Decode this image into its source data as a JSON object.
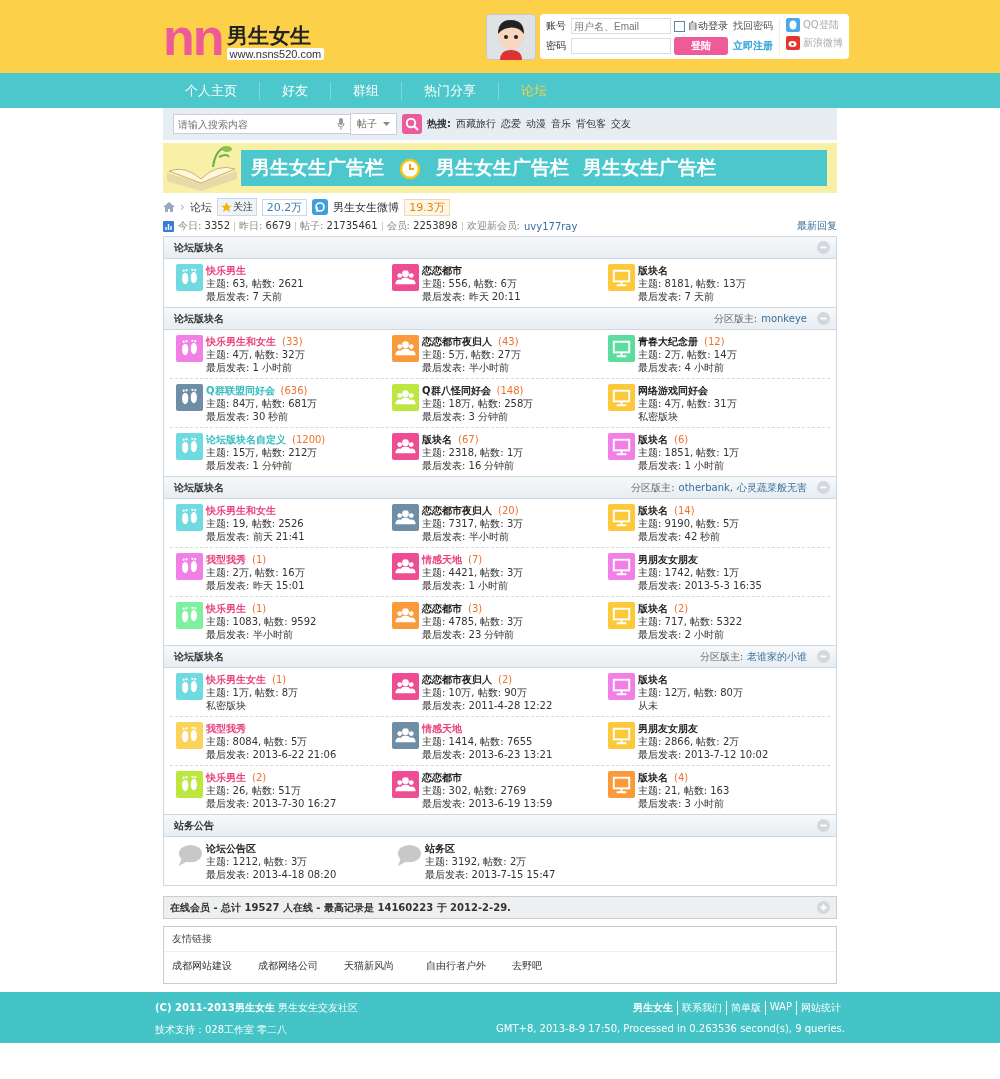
{
  "header": {
    "logo": "nn",
    "site_name": "男生女生",
    "site_url": "www.nsns520.com",
    "login": {
      "account_label": "账号",
      "account_placeholder": "用户名、Email",
      "password_label": "密码",
      "remember": {
        "label": "自动登录",
        "checked": false
      },
      "forgot": "找回密码",
      "submit": "登陆",
      "register": "立即注册",
      "qq": "QQ登陆",
      "weibo": "新浪微博"
    }
  },
  "nav": [
    {
      "label": "个人主页",
      "selected": false
    },
    {
      "label": "好友",
      "selected": false
    },
    {
      "label": "群组",
      "selected": false
    },
    {
      "label": "热门分享",
      "selected": false
    },
    {
      "label": "论坛",
      "selected": true
    }
  ],
  "search": {
    "placeholder": "请输入搜索内容",
    "scope": "帖子",
    "hot_label": "热搜:",
    "hot": [
      "西藏旅行",
      "恋爱",
      "动漫",
      "音乐",
      "背包客",
      "交友"
    ]
  },
  "banner": {
    "texts": [
      "男生女生广告栏",
      "男生女生广告栏",
      "男生女生广告栏"
    ]
  },
  "breadcrumb": {
    "separator": "›",
    "current": "论坛",
    "follow": "关注",
    "follow_count": "20.2万",
    "weibo": "男生女生微博",
    "weibo_count": "19.3万"
  },
  "stats": {
    "items": [
      {
        "label": "今日:",
        "value": "3352"
      },
      {
        "label": "昨日:",
        "value": "6679"
      },
      {
        "label": "帖子:",
        "value": "21735461"
      },
      {
        "label": "会员:",
        "value": "2253898"
      }
    ],
    "welcome": "欢迎新会员:",
    "new_member": "uvy177ray",
    "latest": "最新回复"
  },
  "sections": [
    {
      "title": "论坛版块名",
      "rows": [
        [
          {
            "name": {
              "text": "快乐男生",
              "color": "#e8417f"
            },
            "icon": {
              "kind": "feet",
              "color": "#6fdbe0"
            },
            "stats": "主题: 63, 帖数: 2621",
            "last": "最后发表: 7 天前"
          },
          {
            "name": {
              "text": "恋恋都市",
              "color": "#222222"
            },
            "icon": {
              "kind": "people",
              "color": "#ee4c93"
            },
            "stats": "主题: 556, 帖数: 6万",
            "last": "最后发表: 昨天 20:11"
          },
          {
            "name": {
              "text": "版块名",
              "color": "#222222"
            },
            "icon": {
              "kind": "monitor",
              "color": "#fcc93a"
            },
            "stats": "主题: 8181, 帖数: 13万",
            "last": "最后发表: 7 天前"
          }
        ]
      ]
    },
    {
      "title": "论坛版块名",
      "moderator_label": "分区版主:",
      "moderators": [
        "monkeye"
      ],
      "rows": [
        [
          {
            "name": {
              "text": "快乐男生和女生",
              "color": "#e8417f"
            },
            "count": "(33)",
            "icon": {
              "kind": "feet",
              "color": "#f07fe6"
            },
            "stats": "主题: 4万, 帖数: 32万",
            "last": "最后发表: 1 小时前"
          },
          {
            "name": {
              "text": "恋恋都市夜归人",
              "color": "#222222"
            },
            "count": "(43)",
            "icon": {
              "kind": "people",
              "color": "#fb9a3a"
            },
            "stats": "主题: 5万, 帖数: 27万",
            "last": "最后发表: 半小时前"
          },
          {
            "name": {
              "text": "青春大纪念册",
              "color": "#222222"
            },
            "count": "(12)",
            "icon": {
              "kind": "monitor",
              "color": "#5ddca0"
            },
            "stats": "主题: 2万, 帖数: 14万",
            "last": "最后发表: 4 小时前"
          }
        ],
        [
          {
            "name": {
              "text": "Q群联盟同好会",
              "color": "#36bcc0"
            },
            "count": "(636)",
            "icon": {
              "kind": "feet",
              "color": "#6e8ea6"
            },
            "stats": "主题: 84万, 帖数: 681万",
            "last": "最后发表: 30 秒前"
          },
          {
            "name": {
              "text": "Q群八怪同好会",
              "color": "#222222"
            },
            "count": "(148)",
            "icon": {
              "kind": "people",
              "color": "#bde63f"
            },
            "stats": "主题: 18万, 帖数: 258万",
            "last": "最后发表: 3 分钟前"
          },
          {
            "name": {
              "text": "网络游戏同好会",
              "color": "#222222"
            },
            "icon": {
              "kind": "monitor",
              "color": "#fcc93a"
            },
            "stats": "主题: 4万, 帖数: 31万",
            "last": "私密版块"
          }
        ],
        [
          {
            "name": {
              "text": "论坛版块名自定义",
              "color": "#36bcc0"
            },
            "count": "(1200)",
            "icon": {
              "kind": "feet",
              "color": "#6fdbe0"
            },
            "stats": "主题: 15万, 帖数: 212万",
            "last": "最后发表: 1 分钟前"
          },
          {
            "name": {
              "text": "版块名",
              "color": "#222222"
            },
            "count": "(67)",
            "icon": {
              "kind": "people",
              "color": "#ee4c93"
            },
            "stats": "主题: 2318, 帖数: 1万",
            "last": "最后发表: 16 分钟前"
          },
          {
            "name": {
              "text": "版块名",
              "color": "#222222"
            },
            "count": "(6)",
            "icon": {
              "kind": "monitor",
              "color": "#f07fe6"
            },
            "stats": "主题: 1851, 帖数: 1万",
            "last": "最后发表: 1 小时前"
          }
        ]
      ]
    },
    {
      "title": "论坛版块名",
      "moderator_label": "分区版主:",
      "moderators": [
        "otherbank,",
        "心灵蔬菜般无害"
      ],
      "rows": [
        [
          {
            "name": {
              "text": "快乐男生和女生",
              "color": "#e8417f"
            },
            "icon": {
              "kind": "feet",
              "color": "#6fdbe0"
            },
            "stats": "主题: 19, 帖数: 2526",
            "last": "最后发表: 前天 21:41"
          },
          {
            "name": {
              "text": "恋恋都市夜归人",
              "color": "#222222"
            },
            "count": "(20)",
            "icon": {
              "kind": "people",
              "color": "#6e8ea6"
            },
            "stats": "主题: 7317, 帖数: 3万",
            "last": "最后发表: 半小时前"
          },
          {
            "name": {
              "text": "版块名",
              "color": "#222222"
            },
            "count": "(14)",
            "icon": {
              "kind": "monitor",
              "color": "#fcc93a"
            },
            "stats": "主题: 9190, 帖数: 5万",
            "last": "最后发表: 42 秒前"
          }
        ],
        [
          {
            "name": {
              "text": "我型我秀",
              "color": "#e8417f"
            },
            "count": "(1)",
            "icon": {
              "kind": "feet",
              "color": "#f07fe6"
            },
            "stats": "主题: 2万, 帖数: 16万",
            "last": "最后发表: 昨天 15:01"
          },
          {
            "name": {
              "text": "情感天地",
              "color": "#e8417f"
            },
            "count": "(7)",
            "icon": {
              "kind": "people",
              "color": "#ee4c93"
            },
            "stats": "主题: 4421, 帖数: 3万",
            "last": "最后发表: 1 小时前"
          },
          {
            "name": {
              "text": "男朋友女朋友",
              "color": "#222222"
            },
            "icon": {
              "kind": "monitor",
              "color": "#f07fe6"
            },
            "stats": "主题: 1742, 帖数: 1万",
            "last": "最后发表: 2013-5-3 16:35"
          }
        ],
        [
          {
            "name": {
              "text": "快乐男生",
              "color": "#e8417f"
            },
            "count": "(1)",
            "icon": {
              "kind": "feet",
              "color": "#7ef0a0"
            },
            "stats": "主题: 1083, 帖数: 9592",
            "last": "最后发表: 半小时前"
          },
          {
            "name": {
              "text": "恋恋都市",
              "color": "#222222"
            },
            "count": "(3)",
            "icon": {
              "kind": "people",
              "color": "#fb9a3a"
            },
            "stats": "主题: 4785, 帖数: 3万",
            "last": "最后发表: 23 分钟前"
          },
          {
            "name": {
              "text": "版块名",
              "color": "#222222"
            },
            "count": "(2)",
            "icon": {
              "kind": "monitor",
              "color": "#fcc93a"
            },
            "stats": "主题: 717, 帖数: 5322",
            "last": "最后发表: 2 小时前"
          }
        ]
      ]
    },
    {
      "title": "论坛版块名",
      "moderator_label": "分区版主:",
      "moderators": [
        "老谁家的小谁"
      ],
      "rows": [
        [
          {
            "name": {
              "text": "快乐男生女生",
              "color": "#e8417f"
            },
            "count": "(1)",
            "icon": {
              "kind": "feet",
              "color": "#6fdbe0"
            },
            "stats": "主题: 1万, 帖数: 8万",
            "last": "私密版块"
          },
          {
            "name": {
              "text": "恋恋都市夜归人",
              "color": "#222222"
            },
            "count": "(2)",
            "icon": {
              "kind": "people",
              "color": "#ee4c93"
            },
            "stats": "主题: 10万, 帖数: 90万",
            "last": "最后发表: 2011-4-28 12:22"
          },
          {
            "name": {
              "text": "版块名",
              "color": "#222222"
            },
            "icon": {
              "kind": "monitor",
              "color": "#f07fe6"
            },
            "stats": "主题: 12万, 帖数: 80万",
            "last": "从未"
          }
        ],
        [
          {
            "name": {
              "text": "我型我秀",
              "color": "#e8417f"
            },
            "icon": {
              "kind": "feet",
              "color": "#fcd35a"
            },
            "stats": "主题: 8084, 帖数: 5万",
            "last": "最后发表: 2013-6-22 21:06"
          },
          {
            "name": {
              "text": "情感天地",
              "color": "#e8417f"
            },
            "icon": {
              "kind": "people",
              "color": "#6e8ea6"
            },
            "stats": "主题: 1414, 帖数: 7655",
            "last": "最后发表: 2013-6-23 13:21"
          },
          {
            "name": {
              "text": "男朋友女朋友",
              "color": "#222222"
            },
            "icon": {
              "kind": "monitor",
              "color": "#fcc93a"
            },
            "stats": "主题: 2866, 帖数: 2万",
            "last": "最后发表: 2013-7-12 10:02"
          }
        ],
        [
          {
            "name": {
              "text": "快乐男生",
              "color": "#e8417f"
            },
            "count": "(2)",
            "icon": {
              "kind": "feet",
              "color": "#bde63f"
            },
            "stats": "主题: 26, 帖数: 51万",
            "last": "最后发表: 2013-7-30 16:27"
          },
          {
            "name": {
              "text": "恋恋都市",
              "color": "#222222"
            },
            "icon": {
              "kind": "people",
              "color": "#ee4c93"
            },
            "stats": "主题: 302, 帖数: 2769",
            "last": "最后发表: 2013-6-19 13:59"
          },
          {
            "name": {
              "text": "版块名",
              "color": "#222222"
            },
            "count": "(4)",
            "icon": {
              "kind": "monitor",
              "color": "#fb9a3a"
            },
            "stats": "主题: 21, 帖数: 163",
            "last": "最后发表: 3 小时前"
          }
        ]
      ]
    },
    {
      "title": "站务公告",
      "rows": [
        [
          {
            "name": {
              "text": "论坛公告区",
              "color": "#222222"
            },
            "icon": {
              "kind": "bubble",
              "color": "#c8c8c8"
            },
            "stats": "主题: 1212, 帖数: 3万",
            "last": "最后发表: 2013-4-18 08:20"
          },
          {
            "name": {
              "text": "站务区",
              "color": "#222222"
            },
            "icon": {
              "kind": "bubble",
              "color": "#c8c8c8"
            },
            "stats": "主题: 3192, 帖数: 2万",
            "last": "最后发表: 2013-7-15 15:47"
          }
        ]
      ]
    }
  ],
  "online": {
    "text": "在线会员 - 总计 19527 人在线 - 最高记录是 14160223 于 2012-2-29."
  },
  "friend_links": {
    "title": "友情链接",
    "links": [
      "成都网站建设",
      "成都网络公司",
      "天猫新风尚",
      "自由行者户外",
      "去野吧"
    ]
  },
  "footer": {
    "copyright": "(C) 2011-2013男生女生",
    "community": "男生女生交友社区",
    "links": [
      "男生女生",
      "联系我们",
      "简单版",
      "WAP",
      "网站统计"
    ],
    "support": "技术支持：028工作室 零二八",
    "info": "GMT+8, 2013-8-9 17:50, Processed in 0.263536 second(s), 9 queries."
  }
}
